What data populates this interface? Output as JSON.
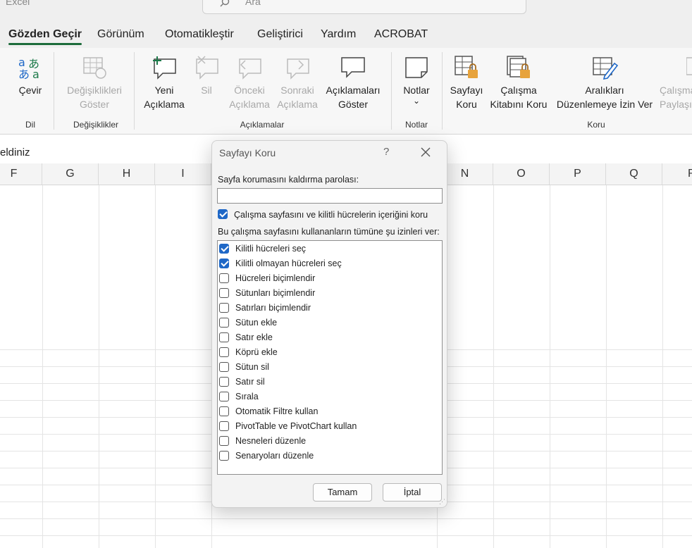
{
  "app": {
    "title": "Excel",
    "search_placeholder": "Ara"
  },
  "tabs": [
    "Gözden Geçir",
    "Görünüm",
    "Otomatikleştir",
    "Geliştirici",
    "Yardım",
    "ACROBAT"
  ],
  "ribbon": {
    "cevir": "Çevir",
    "degisiklikleri_1": "Değişiklikleri",
    "degisiklikleri_2": "Göster",
    "yeni_1": "Yeni",
    "yeni_2": "Açıklama",
    "sil": "Sil",
    "onceki_1": "Önceki",
    "onceki_2": "Açıklama",
    "sonraki_1": "Sonraki",
    "sonraki_2": "Açıklama",
    "goster_1": "Açıklamaları",
    "goster_2": "Göster",
    "notlar": "Notlar",
    "notlar_chevron": "⌄",
    "sayfayi_1": "Sayfayı",
    "sayfayi_2": "Koru",
    "calisma_1": "Çalışma",
    "calisma_2": "Kitabını Koru",
    "araliklari_1": "Aralıkları",
    "araliklari_2": "Düzenlemeye İzin Ver",
    "paylas_1": "Çalışma",
    "paylas_2": "Paylaşı",
    "groups": {
      "dil": "Dil",
      "degisiklikler": "Değişiklikler",
      "aciklamalar": "Açıklamalar",
      "notlar": "Notlar",
      "koru": "Koru"
    }
  },
  "formula_text": "eldiniz",
  "columns": [
    "F",
    "G",
    "H",
    "I",
    "N",
    "O",
    "P",
    "Q",
    "R"
  ],
  "dialog": {
    "title": "Sayfayı Koru",
    "help": "?",
    "password_label": "Sayfa korumasını kaldırma parolası:",
    "password_value": "",
    "protect_label": "Çalışma sayfasını ve kilitli hücrelerin içeriğini koru",
    "protect_checked": true,
    "allow_label": "Bu çalışma sayfasını kullananların tümüne şu izinleri ver:",
    "permissions": [
      {
        "label": "Kilitli hücreleri seç",
        "checked": true
      },
      {
        "label": "Kilitli olmayan hücreleri seç",
        "checked": true
      },
      {
        "label": "Hücreleri biçimlendir",
        "checked": false
      },
      {
        "label": "Sütunları biçimlendir",
        "checked": false
      },
      {
        "label": "Satırları biçimlendir",
        "checked": false
      },
      {
        "label": "Sütun ekle",
        "checked": false
      },
      {
        "label": "Satır ekle",
        "checked": false
      },
      {
        "label": "Köprü ekle",
        "checked": false
      },
      {
        "label": "Sütun sil",
        "checked": false
      },
      {
        "label": "Satır sil",
        "checked": false
      },
      {
        "label": "Sırala",
        "checked": false
      },
      {
        "label": "Otomatik Filtre kullan",
        "checked": false
      },
      {
        "label": "PivotTable ve PivotChart kullan",
        "checked": false
      },
      {
        "label": "Nesneleri düzenle",
        "checked": false
      },
      {
        "label": "Senaryoları düzenle",
        "checked": false
      }
    ],
    "ok": "Tamam",
    "cancel": "İptal"
  }
}
